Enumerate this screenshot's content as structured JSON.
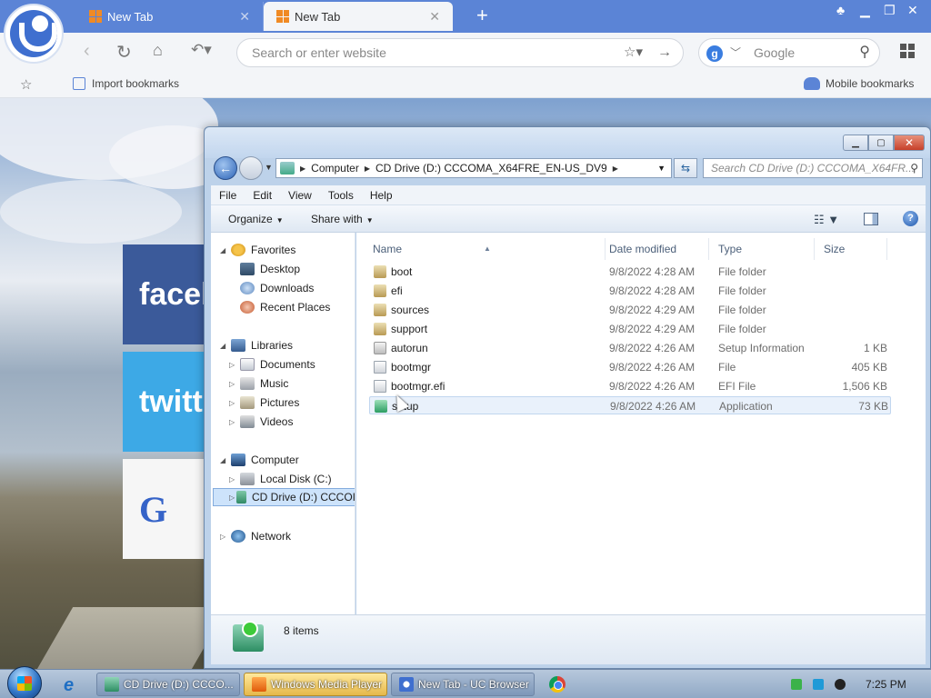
{
  "browser": {
    "tabs": [
      {
        "label": "New Tab",
        "active": false
      },
      {
        "label": "New Tab",
        "active": true
      }
    ],
    "address_placeholder": "Search or enter website",
    "search_engine": "Google",
    "bookmarks": {
      "import_label": "Import bookmarks",
      "mobile_label": "Mobile bookmarks"
    },
    "background_tiles": [
      "facel",
      "twitt",
      "G"
    ]
  },
  "explorer": {
    "breadcrumb": [
      "Computer",
      "CD Drive (D:) CCCOMA_X64FRE_EN-US_DV9"
    ],
    "search_placeholder": "Search CD Drive (D:) CCCOMA_X64FR...",
    "menu": [
      "File",
      "Edit",
      "View",
      "Tools",
      "Help"
    ],
    "commands": {
      "organize": "Organize",
      "share": "Share with"
    },
    "nav": {
      "favorites": "Favorites",
      "desktop": "Desktop",
      "downloads": "Downloads",
      "recent": "Recent Places",
      "libraries": "Libraries",
      "documents": "Documents",
      "music": "Music",
      "pictures": "Pictures",
      "videos": "Videos",
      "computer": "Computer",
      "local_disk": "Local Disk (C:)",
      "cd_drive": "CD Drive (D:) CCCOI",
      "network": "Network"
    },
    "columns": [
      "Name",
      "Date modified",
      "Type",
      "Size"
    ],
    "files": [
      {
        "name": "boot",
        "date": "9/8/2022 4:28 AM",
        "type": "File folder",
        "size": "",
        "icon": "folder"
      },
      {
        "name": "efi",
        "date": "9/8/2022 4:28 AM",
        "type": "File folder",
        "size": "",
        "icon": "folder"
      },
      {
        "name": "sources",
        "date": "9/8/2022 4:29 AM",
        "type": "File folder",
        "size": "",
        "icon": "folder"
      },
      {
        "name": "support",
        "date": "9/8/2022 4:29 AM",
        "type": "File folder",
        "size": "",
        "icon": "folder"
      },
      {
        "name": "autorun",
        "date": "9/8/2022 4:26 AM",
        "type": "Setup Information",
        "size": "1 KB",
        "icon": "setupinfo"
      },
      {
        "name": "bootmgr",
        "date": "9/8/2022 4:26 AM",
        "type": "File",
        "size": "405 KB",
        "icon": "file"
      },
      {
        "name": "bootmgr.efi",
        "date": "9/8/2022 4:26 AM",
        "type": "EFI File",
        "size": "1,506 KB",
        "icon": "file"
      },
      {
        "name": "setup",
        "date": "9/8/2022 4:26 AM",
        "type": "Application",
        "size": "73 KB",
        "icon": "app"
      }
    ],
    "status": "8 items"
  },
  "taskbar": {
    "items": [
      "CD Drive (D:) CCCO...",
      "Windows Media Player",
      "New Tab - UC Browser"
    ],
    "clock": "7:25 PM"
  }
}
